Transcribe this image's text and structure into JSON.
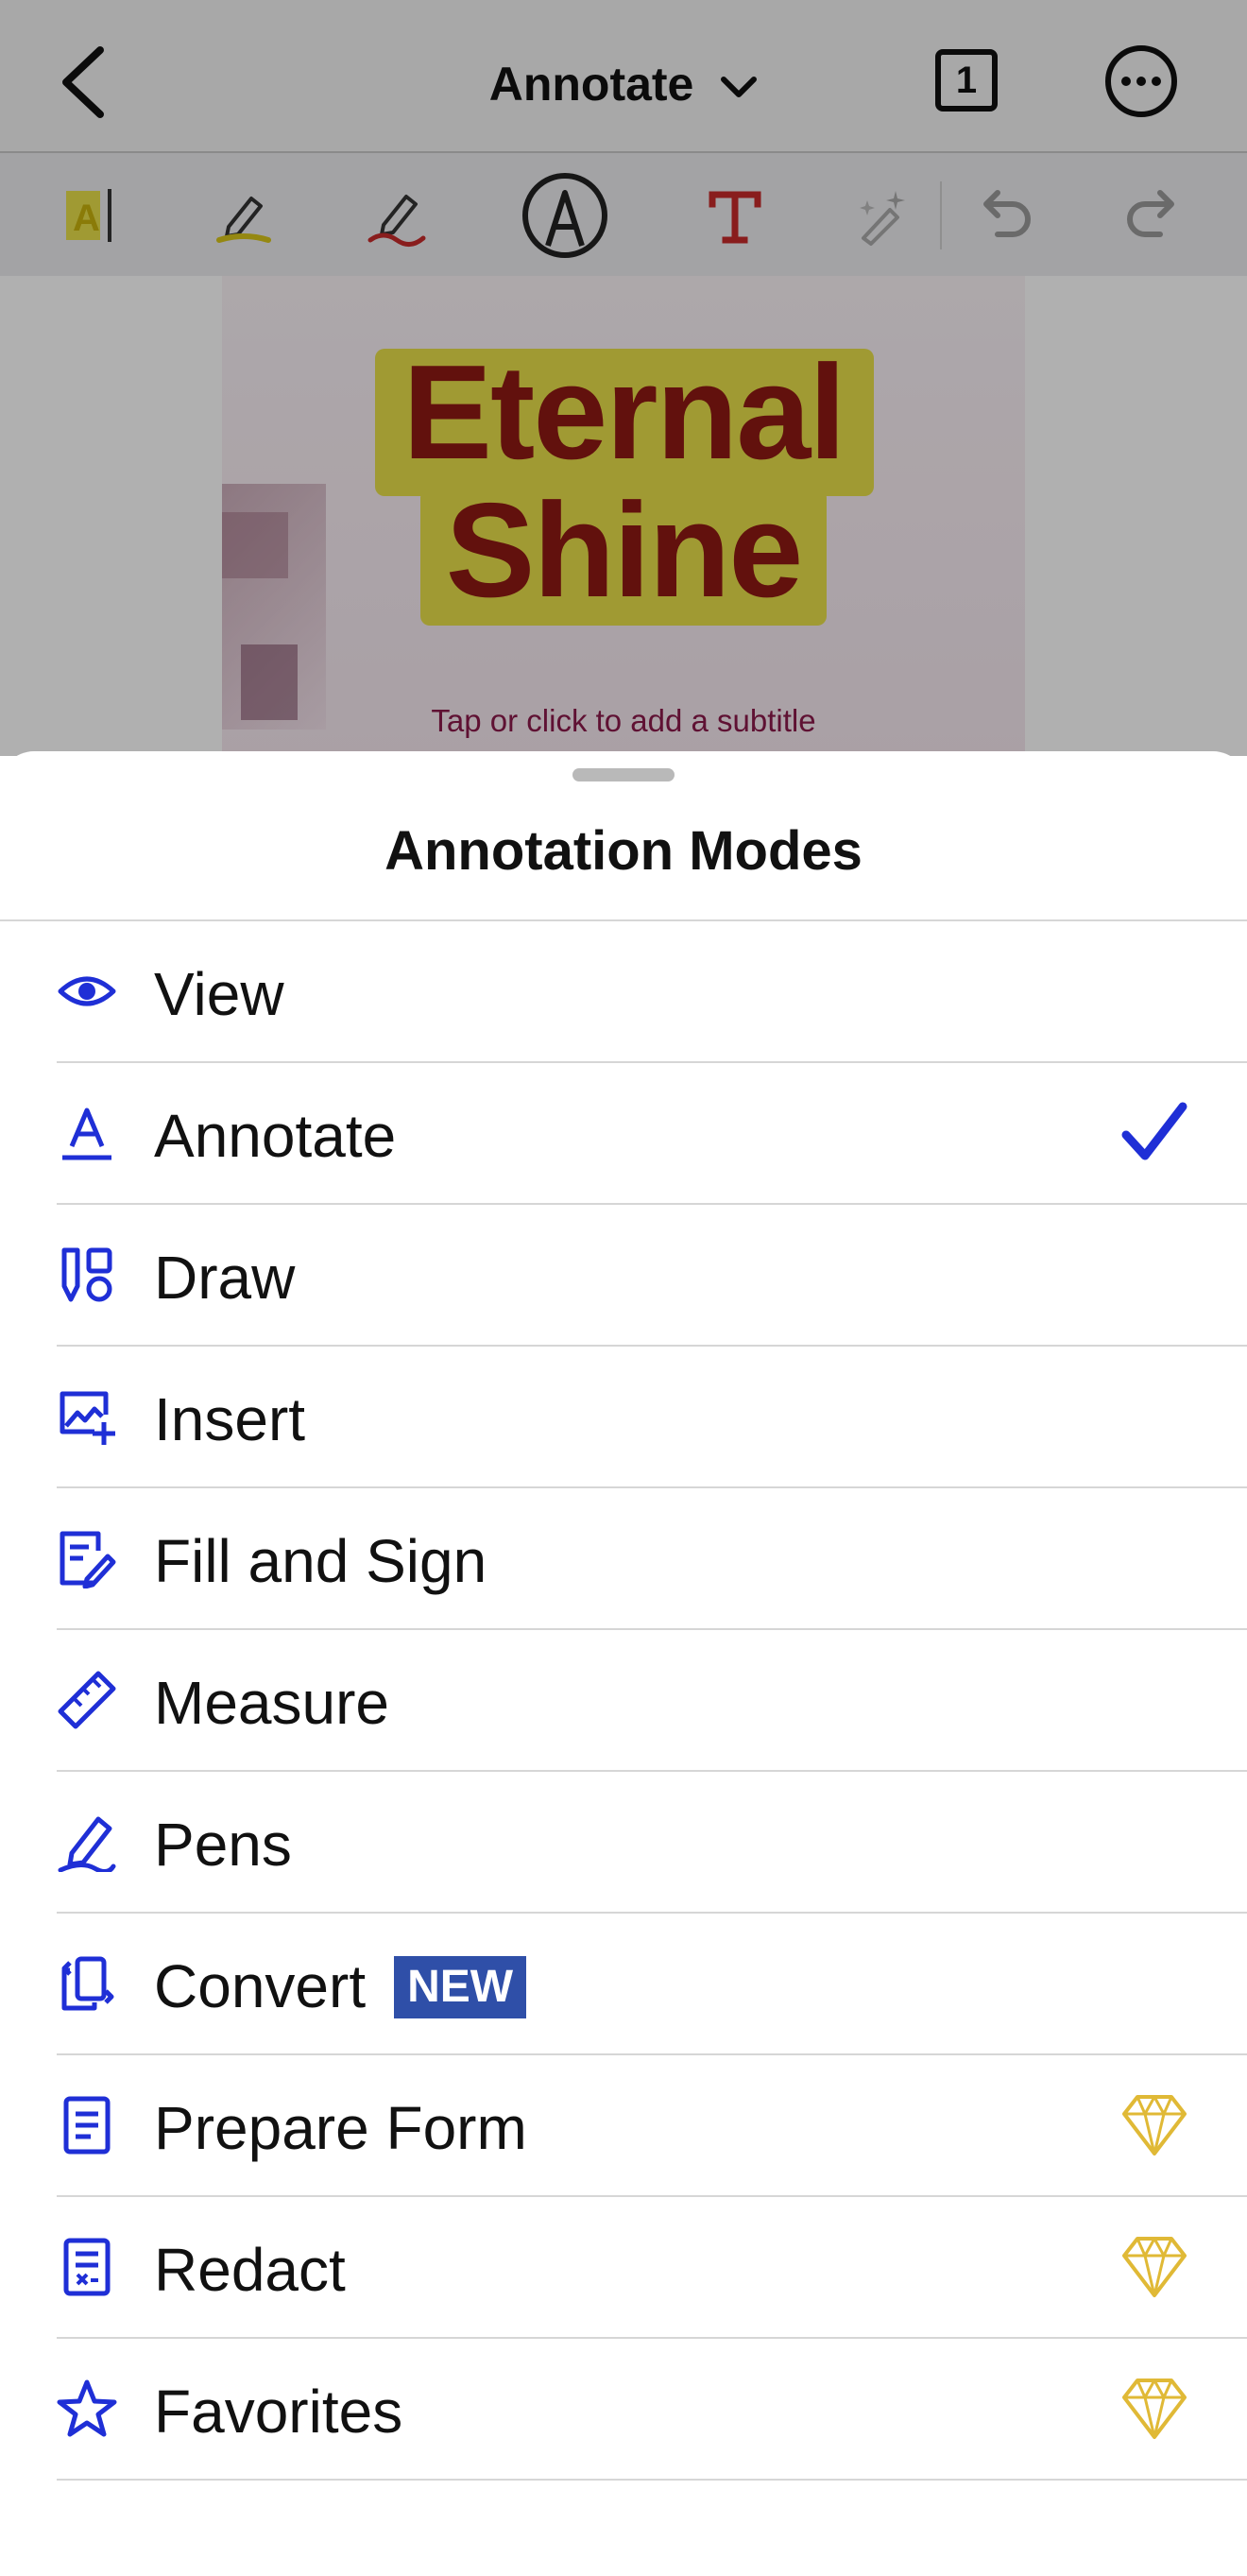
{
  "navbar": {
    "title": "Annotate",
    "page_number": "1"
  },
  "toolbar": {
    "tools": [
      "text-highlight-icon",
      "highlighter-pen-icon",
      "red-pen-icon",
      "stylus-circle-icon",
      "text-tool-icon",
      "magic-eraser-icon",
      "undo-icon",
      "redo-icon"
    ]
  },
  "document": {
    "title": "Eternal Shine",
    "subtitle": "Tap or click to add a subtitle"
  },
  "sheet": {
    "title": "Annotation Modes",
    "items": [
      {
        "label": "View",
        "icon": "eye-icon"
      },
      {
        "label": "Annotate",
        "icon": "text-underline-icon",
        "selected": true
      },
      {
        "label": "Draw",
        "icon": "draw-shapes-icon"
      },
      {
        "label": "Insert",
        "icon": "insert-image-icon"
      },
      {
        "label": "Fill and Sign",
        "icon": "fill-sign-icon"
      },
      {
        "label": "Measure",
        "icon": "ruler-icon"
      },
      {
        "label": "Pens",
        "icon": "pen-icon"
      },
      {
        "label": "Convert",
        "icon": "convert-icon",
        "badge": "NEW"
      },
      {
        "label": "Prepare Form",
        "icon": "form-icon",
        "premium": true
      },
      {
        "label": "Redact",
        "icon": "redact-icon",
        "premium": true
      },
      {
        "label": "Favorites",
        "icon": "star-icon",
        "premium": true
      }
    ]
  },
  "colors": {
    "accent": "#1f2fd6",
    "title_text": "#8f1a14",
    "highlight": "#e8e04a",
    "badge": "#2f4fa8",
    "premium": "#e0b936"
  }
}
